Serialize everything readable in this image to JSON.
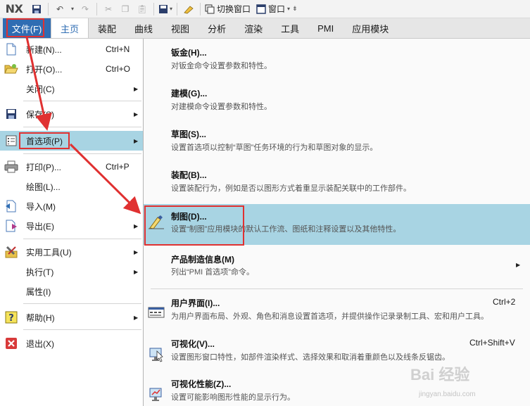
{
  "toolbar": {
    "logo": "NX",
    "switch_window": "切换窗口",
    "window": "窗口"
  },
  "ribbon": {
    "file": "文件(F)",
    "tabs": [
      "主页",
      "装配",
      "曲线",
      "视图",
      "分析",
      "渲染",
      "工具",
      "PMI",
      "应用模块"
    ]
  },
  "file_menu": {
    "items": [
      {
        "label": "新建(N)...",
        "shortcut": "Ctrl+N"
      },
      {
        "label": "打开(O)...",
        "shortcut": "Ctrl+O"
      },
      {
        "label": "关闭(C)"
      },
      {
        "label": "保存(S)"
      },
      {
        "label": "首选项(P)"
      },
      {
        "label": "打印(P)...",
        "shortcut": "Ctrl+P"
      },
      {
        "label": "绘图(L)..."
      },
      {
        "label": "导入(M)"
      },
      {
        "label": "导出(E)"
      },
      {
        "label": "实用工具(U)"
      },
      {
        "label": "执行(T)"
      },
      {
        "label": "属性(I)"
      },
      {
        "label": "帮助(H)"
      },
      {
        "label": "退出(X)"
      }
    ]
  },
  "preferences_menu": {
    "items": [
      {
        "title": "钣金(H)...",
        "desc": "对钣金命令设置参数和特性。"
      },
      {
        "title": "建模(G)...",
        "desc": "对建模命令设置参数和特性。"
      },
      {
        "title": "草图(S)...",
        "desc": "设置首选项以控制“草图”任务环境的行为和草图对象的显示。"
      },
      {
        "title": "装配(B)...",
        "desc": "设置装配行为，例如是否以图形方式着重显示装配关联中的工作部件。"
      },
      {
        "title": "制图(D)...",
        "desc": "设置“制图”应用模块的默认工作流、图纸和注释设置以及其他特性。"
      },
      {
        "title": "产品制造信息(M)",
        "desc": "列出“PMI 首选项”命令。"
      },
      {
        "title": "用户界面(I)...",
        "desc": "为用户界面布局、外观、角色和消息设置首选项，并提供操作记录录制工具、宏和用户工具。",
        "shortcut": "Ctrl+2"
      },
      {
        "title": "可视化(V)...",
        "desc": "设置图形窗口特性，如部件渲染样式、选择效果和取消着重颜色以及线条反锯齿。",
        "shortcut": "Ctrl+Shift+V"
      },
      {
        "title": "可视化性能(Z)...",
        "desc": "设置可能影响图形性能的显示行为。"
      }
    ]
  },
  "watermark": {
    "brand": "Bai  经验",
    "url": "jingyan.baidu.com"
  },
  "colors": {
    "highlight": "#a8d4e3",
    "file_tab": "#2f6db3",
    "annotation": "#e03131"
  }
}
